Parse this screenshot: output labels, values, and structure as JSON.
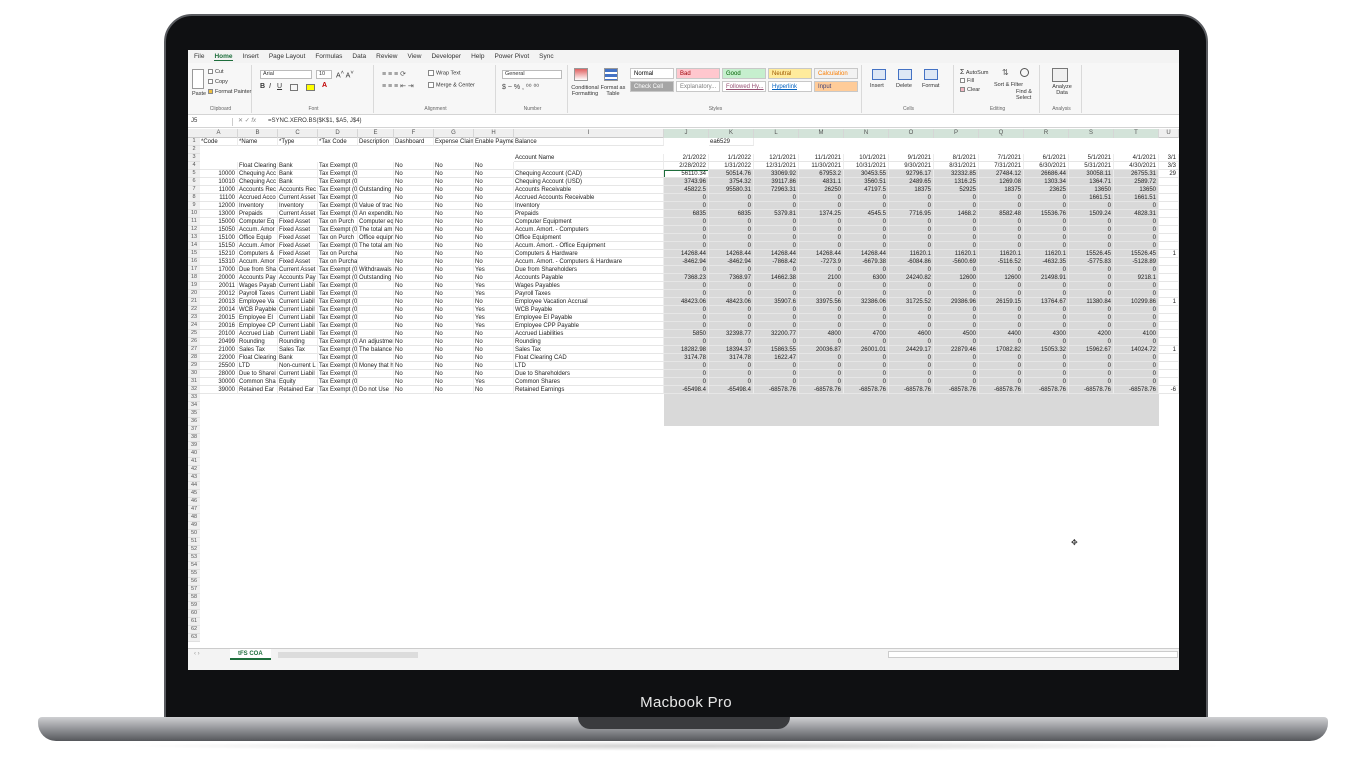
{
  "device_label": "Macbook Pro",
  "menu_tabs": [
    "File",
    "Home",
    "Insert",
    "Page Layout",
    "Formulas",
    "Data",
    "Review",
    "View",
    "Developer",
    "Help",
    "Power Pivot",
    "Sync"
  ],
  "ribbon": {
    "clipboard": {
      "cut": "Cut",
      "copy": "Copy",
      "format_painter": "Format Painter",
      "paste": "Paste",
      "label": "Clipboard"
    },
    "font": {
      "name": "Arial",
      "size": "10",
      "label": "Font"
    },
    "alignment": {
      "wrap": "Wrap Text",
      "merge": "Merge & Center",
      "label": "Alignment"
    },
    "number": {
      "format": "General",
      "label": "Number"
    },
    "styles": {
      "conditional": "Conditional Formatting",
      "format_table": "Format as Table",
      "label": "Styles",
      "items": [
        {
          "t": "Normal",
          "bg": "#ffffff",
          "fg": "#000000"
        },
        {
          "t": "Bad",
          "bg": "#ffc7ce",
          "fg": "#9c0006"
        },
        {
          "t": "Good",
          "bg": "#c6efce",
          "fg": "#006100"
        },
        {
          "t": "Neutral",
          "bg": "#ffeb9c",
          "fg": "#9c5700"
        },
        {
          "t": "Calculation",
          "bg": "#f2f2f2",
          "fg": "#fa7d00"
        },
        {
          "t": "Check Cell",
          "bg": "#a5a5a5",
          "fg": "#ffffff"
        },
        {
          "t": "Explanatory...",
          "bg": "#ffffff",
          "fg": "#7f7f7f"
        },
        {
          "t": "Followed Hy...",
          "bg": "#ffffff",
          "fg": "#954f72"
        },
        {
          "t": "Hyperlink",
          "bg": "#ffffff",
          "fg": "#0563c1"
        },
        {
          "t": "Input",
          "bg": "#ffcc99",
          "fg": "#3f3f76"
        }
      ]
    },
    "cells": {
      "insert": "Insert",
      "delete": "Delete",
      "format": "Format",
      "label": "Cells"
    },
    "editing": {
      "autosum": "AutoSum",
      "fill": "Fill",
      "clear": "Clear",
      "sort": "Sort & Filter",
      "find": "Find & Select",
      "label": "Editing"
    },
    "analysis": {
      "analyze": "Analyze Data",
      "label": "Analysis"
    }
  },
  "formula_bar": {
    "name_box": "J5",
    "formula": "=SYNC.XERO.BS($K$1, $A5, J$4)"
  },
  "columns": [
    "A",
    "B",
    "C",
    "D",
    "E",
    "F",
    "G",
    "H",
    "I",
    "J",
    "K",
    "L",
    "M",
    "N",
    "O",
    "P",
    "Q",
    "R",
    "S",
    "T",
    "U"
  ],
  "header_row": [
    "*Code",
    "*Name",
    "*Type",
    "*Tax Code",
    "Description",
    "Dashboard",
    "Expense Claims",
    "Enable Payments",
    "Balance"
  ],
  "k1": "ea6529",
  "i3": "Account Name",
  "dates_start": [
    "2/1/2022",
    "1/1/2022",
    "12/1/2021",
    "11/1/2021",
    "10/1/2021",
    "9/1/2021",
    "8/1/2021",
    "7/1/2021",
    "6/1/2021",
    "5/1/2021",
    "4/1/2021",
    "3/1"
  ],
  "dates_end": [
    "2/28/2022",
    "1/31/2022",
    "12/31/2021",
    "11/30/2021",
    "10/31/2021",
    "9/30/2021",
    "8/31/2021",
    "7/31/2021",
    "6/30/2021",
    "5/31/2021",
    "4/30/2021",
    "3/3"
  ],
  "rows": [
    {
      "a": "",
      "b": "Float Clearing",
      "c": "Bank",
      "d": "Tax Exempt (0%)",
      "e": "",
      "f": "No",
      "g": "No",
      "h": "No",
      "i": "",
      "v": []
    },
    {
      "a": "10000",
      "b": "Chequing Acc",
      "c": "Bank",
      "d": "Tax Exempt (0%)",
      "e": "",
      "f": "No",
      "g": "No",
      "h": "No",
      "i": "Chequing Account (CAD)",
      "v": [
        "56110.34",
        "50514.76",
        "33069.92",
        "67953.2",
        "30453.55",
        "92796.17",
        "32332.85",
        "27484.12",
        "26686.44",
        "30058.11",
        "26755.31",
        "29"
      ]
    },
    {
      "a": "10010",
      "b": "Chequing Acc",
      "c": "Bank",
      "d": "Tax Exempt (0%)",
      "e": "",
      "f": "No",
      "g": "No",
      "h": "No",
      "i": "Chequing Account (USD)",
      "v": [
        "3743.96",
        "3754.32",
        "39117.86",
        "4831.1",
        "3560.51",
        "2489.65",
        "1316.25",
        "1269.08",
        "1303.34",
        "1364.71",
        "2589.72",
        ""
      ]
    },
    {
      "a": "11000",
      "b": "Accounts Rec",
      "c": "Accounts Rec",
      "d": "Tax Exempt (0%)",
      "e": "Outstanding",
      "f": "No",
      "g": "No",
      "h": "No",
      "i": "Accounts Receivable",
      "v": [
        "45822.5",
        "95580.31",
        "72963.31",
        "26250",
        "47197.5",
        "18375",
        "52925",
        "18375",
        "23625",
        "13650",
        "13650",
        ""
      ]
    },
    {
      "a": "11100",
      "b": "Accrued Acco",
      "c": "Current Asset",
      "d": "Tax Exempt (0%)",
      "e": "",
      "f": "No",
      "g": "No",
      "h": "No",
      "i": "Accrued Accounts Receivable",
      "v": [
        "0",
        "0",
        "0",
        "0",
        "0",
        "0",
        "0",
        "0",
        "0",
        "1661.51",
        "1661.51",
        ""
      ]
    },
    {
      "a": "12000",
      "b": "Inventory",
      "c": "Inventory",
      "d": "Tax Exempt (0%)",
      "e": "Value of trac",
      "f": "No",
      "g": "No",
      "h": "No",
      "i": "Inventory",
      "v": [
        "0",
        "0",
        "0",
        "0",
        "0",
        "0",
        "0",
        "0",
        "0",
        "0",
        "0",
        ""
      ]
    },
    {
      "a": "13000",
      "b": "Prepaids",
      "c": "Current Asset",
      "d": "Tax Exempt (0%)",
      "e": "An expenditu",
      "f": "No",
      "g": "No",
      "h": "No",
      "i": "Prepaids",
      "v": [
        "6835",
        "6835",
        "5379.81",
        "1374.25",
        "4545.5",
        "7716.95",
        "1468.2",
        "8582.48",
        "15536.76",
        "1509.24",
        "4828.31",
        ""
      ]
    },
    {
      "a": "15000",
      "b": "Computer Eq",
      "c": "Fixed Asset",
      "d": "Tax on Purch",
      "e": "Computer eq",
      "f": "No",
      "g": "No",
      "h": "No",
      "i": "Computer Equipment",
      "v": [
        "0",
        "0",
        "0",
        "0",
        "0",
        "0",
        "0",
        "0",
        "0",
        "0",
        "0",
        ""
      ]
    },
    {
      "a": "15050",
      "b": "Accum. Amor",
      "c": "Fixed Asset",
      "d": "Tax Exempt (0%)",
      "e": "The total am",
      "f": "No",
      "g": "No",
      "h": "No",
      "i": "Accum. Amort. - Computers",
      "v": [
        "0",
        "0",
        "0",
        "0",
        "0",
        "0",
        "0",
        "0",
        "0",
        "0",
        "0",
        ""
      ]
    },
    {
      "a": "15100",
      "b": "Office Equip",
      "c": "Fixed Asset",
      "d": "Tax on Purch",
      "e": "Office equipr",
      "f": "No",
      "g": "No",
      "h": "No",
      "i": "Office Equipment",
      "v": [
        "0",
        "0",
        "0",
        "0",
        "0",
        "0",
        "0",
        "0",
        "0",
        "0",
        "0",
        ""
      ]
    },
    {
      "a": "15150",
      "b": "Accum. Amor",
      "c": "Fixed Asset",
      "d": "Tax Exempt (0%)",
      "e": "The total am",
      "f": "No",
      "g": "No",
      "h": "No",
      "i": "Accum. Amort. - Office Equipment",
      "v": [
        "0",
        "0",
        "0",
        "0",
        "0",
        "0",
        "0",
        "0",
        "0",
        "0",
        "0",
        ""
      ]
    },
    {
      "a": "15210",
      "b": "Computers &",
      "c": "Fixed Asset",
      "d": "Tax on Purchases (0%)",
      "e": "",
      "f": "No",
      "g": "No",
      "h": "No",
      "i": "Computers & Hardware",
      "v": [
        "14268.44",
        "14268.44",
        "14268.44",
        "14268.44",
        "14268.44",
        "11620.1",
        "11620.1",
        "11620.1",
        "11620.1",
        "15526.45",
        "15526.45",
        "1"
      ]
    },
    {
      "a": "15310",
      "b": "Accum. Amor",
      "c": "Fixed Asset",
      "d": "Tax on Purchases (0%)",
      "e": "",
      "f": "No",
      "g": "No",
      "h": "No",
      "i": "Accum. Amort. - Computers & Hardware",
      "v": [
        "-8462.94",
        "-8462.94",
        "-7868.42",
        "-7273.9",
        "-6679.38",
        "-6084.86",
        "-5600.69",
        "-5116.52",
        "-4632.35",
        "-5775.83",
        "-5128.89",
        ""
      ]
    },
    {
      "a": "17000",
      "b": "Due from Sha",
      "c": "Current Asset",
      "d": "Tax Exempt (0%)",
      "e": "Withdrawals",
      "f": "No",
      "g": "No",
      "h": "Yes",
      "i": "Due from Shareholders",
      "v": [
        "0",
        "0",
        "0",
        "0",
        "0",
        "0",
        "0",
        "0",
        "0",
        "0",
        "0",
        ""
      ]
    },
    {
      "a": "20000",
      "b": "Accounts Pay",
      "c": "Accounts Pay",
      "d": "Tax Exempt (0%)",
      "e": "Outstanding",
      "f": "No",
      "g": "No",
      "h": "No",
      "i": "Accounts Payable",
      "v": [
        "7368.23",
        "7368.97",
        "14662.38",
        "2100",
        "6300",
        "24240.82",
        "12600",
        "12600",
        "21498.91",
        "0",
        "9218.1",
        ""
      ]
    },
    {
      "a": "20011",
      "b": "Wages Payab",
      "c": "Current Liabil",
      "d": "Tax Exempt (0%)",
      "e": "",
      "f": "No",
      "g": "No",
      "h": "Yes",
      "i": "Wages Payables",
      "v": [
        "0",
        "0",
        "0",
        "0",
        "0",
        "0",
        "0",
        "0",
        "0",
        "0",
        "0",
        ""
      ]
    },
    {
      "a": "20012",
      "b": "Payroll Taxes",
      "c": "Current Liabil",
      "d": "Tax Exempt (0%)",
      "e": "",
      "f": "No",
      "g": "No",
      "h": "Yes",
      "i": "Payroll Taxes",
      "v": [
        "0",
        "0",
        "0",
        "0",
        "0",
        "0",
        "0",
        "0",
        "0",
        "0",
        "0",
        ""
      ]
    },
    {
      "a": "20013",
      "b": "Employee Va",
      "c": "Current Liabil",
      "d": "Tax Exempt (0%)",
      "e": "",
      "f": "No",
      "g": "No",
      "h": "No",
      "i": "Employee Vacation Accrual",
      "v": [
        "48423.06",
        "48423.06",
        "35907.6",
        "33975.56",
        "32386.06",
        "31725.52",
        "29386.96",
        "26159.15",
        "13764.67",
        "11380.84",
        "10299.86",
        "1"
      ]
    },
    {
      "a": "20014",
      "b": "WCB Payable",
      "c": "Current Liabil",
      "d": "Tax Exempt (0%)",
      "e": "",
      "f": "No",
      "g": "No",
      "h": "Yes",
      "i": "WCB Payable",
      "v": [
        "0",
        "0",
        "0",
        "0",
        "0",
        "0",
        "0",
        "0",
        "0",
        "0",
        "0",
        ""
      ]
    },
    {
      "a": "20015",
      "b": "Employee EI",
      "c": "Current Liabil",
      "d": "Tax Exempt (0%)",
      "e": "",
      "f": "No",
      "g": "No",
      "h": "Yes",
      "i": "Employee EI Payable",
      "v": [
        "0",
        "0",
        "0",
        "0",
        "0",
        "0",
        "0",
        "0",
        "0",
        "0",
        "0",
        ""
      ]
    },
    {
      "a": "20016",
      "b": "Employee CP",
      "c": "Current Liabil",
      "d": "Tax Exempt (0%)",
      "e": "",
      "f": "No",
      "g": "No",
      "h": "Yes",
      "i": "Employee CPP Payable",
      "v": [
        "0",
        "0",
        "0",
        "0",
        "0",
        "0",
        "0",
        "0",
        "0",
        "0",
        "0",
        ""
      ]
    },
    {
      "a": "20100",
      "b": "Accrued Liab",
      "c": "Current Liabil",
      "d": "Tax Exempt (0%)",
      "e": "",
      "f": "No",
      "g": "No",
      "h": "No",
      "i": "Accrued Liabilities",
      "v": [
        "5850",
        "32398.77",
        "32200.77",
        "4800",
        "4700",
        "4600",
        "4500",
        "4400",
        "4300",
        "4200",
        "4100",
        ""
      ]
    },
    {
      "a": "20499",
      "b": "Rounding",
      "c": "Rounding",
      "d": "Tax Exempt (0%)",
      "e": "An adjustmer",
      "f": "No",
      "g": "No",
      "h": "No",
      "i": "Rounding",
      "v": [
        "0",
        "0",
        "0",
        "0",
        "0",
        "0",
        "0",
        "0",
        "0",
        "0",
        "0",
        ""
      ]
    },
    {
      "a": "21000",
      "b": "Sales Tax",
      "c": "Sales Tax",
      "d": "Tax Exempt (0%)",
      "e": "The balance i",
      "f": "No",
      "g": "No",
      "h": "No",
      "i": "Sales Tax",
      "v": [
        "18282.98",
        "18394.37",
        "15863.55",
        "20036.87",
        "26001.01",
        "24429.17",
        "22879.46",
        "17082.82",
        "15053.32",
        "15962.67",
        "14024.72",
        "1"
      ]
    },
    {
      "a": "22000",
      "b": "Float Clearing",
      "c": "Bank",
      "d": "Tax Exempt (0%)",
      "e": "",
      "f": "No",
      "g": "No",
      "h": "No",
      "i": "Float Clearing CAD",
      "v": [
        "3174.78",
        "3174.78",
        "1622.47",
        "0",
        "0",
        "0",
        "0",
        "0",
        "0",
        "0",
        "0",
        ""
      ]
    },
    {
      "a": "25500",
      "b": "LTD",
      "c": "Non-current L",
      "d": "Tax Exempt (0%)",
      "e": "Money that h",
      "f": "No",
      "g": "No",
      "h": "No",
      "i": "LTD",
      "v": [
        "0",
        "0",
        "0",
        "0",
        "0",
        "0",
        "0",
        "0",
        "0",
        "0",
        "0",
        ""
      ]
    },
    {
      "a": "28000",
      "b": "Due to Sharel",
      "c": "Current Liabil",
      "d": "Tax Exempt (0%)",
      "e": "",
      "f": "No",
      "g": "No",
      "h": "No",
      "i": "Due to Shareholders",
      "v": [
        "0",
        "0",
        "0",
        "0",
        "0",
        "0",
        "0",
        "0",
        "0",
        "0",
        "0",
        ""
      ]
    },
    {
      "a": "30000",
      "b": "Common Sha",
      "c": "Equity",
      "d": "Tax Exempt (0%)",
      "e": "",
      "f": "No",
      "g": "No",
      "h": "Yes",
      "i": "Common Shares",
      "v": [
        "0",
        "0",
        "0",
        "0",
        "0",
        "0",
        "0",
        "0",
        "0",
        "0",
        "0",
        ""
      ]
    },
    {
      "a": "39000",
      "b": "Retained Ear",
      "c": "Retained Ear",
      "d": "Tax Exempt (0%)",
      "e": "Do not Use",
      "f": "No",
      "g": "No",
      "h": "No",
      "i": "Retained Earnings",
      "v": [
        "-65498.4",
        "-65498.4",
        "-68578.76",
        "-68578.76",
        "-68578.76",
        "-68578.76",
        "-68578.76",
        "-68578.76",
        "-68578.76",
        "-68578.76",
        "-68578.76",
        "-6"
      ]
    }
  ],
  "sheet_tab": "tFS COA",
  "colors": {
    "excel_green": "#1e6e3c",
    "selection": "#d9d9d9"
  }
}
